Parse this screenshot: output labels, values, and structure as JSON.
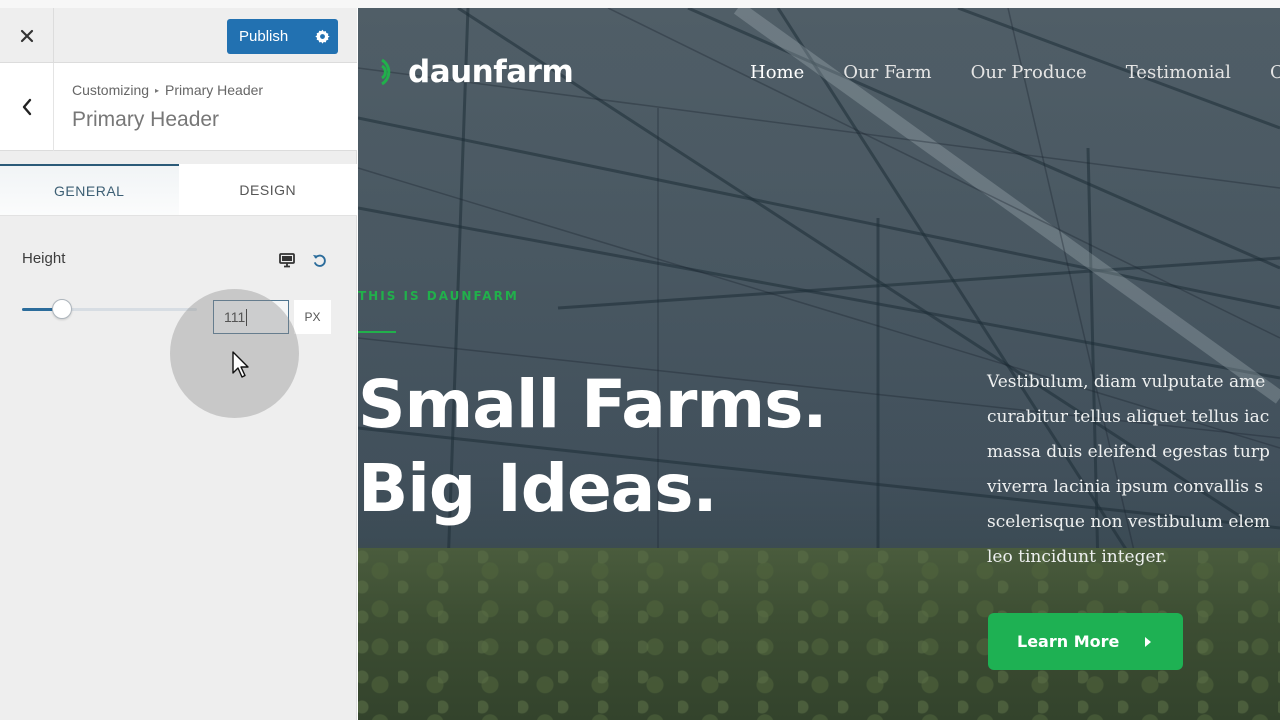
{
  "customizer": {
    "close_label": "Close",
    "publish_label": "Publish",
    "breadcrumb": {
      "root": "Customizing",
      "separator": "▸",
      "current": "Primary Header"
    },
    "section_title": "Primary Header",
    "tabs": [
      {
        "label": "GENERAL",
        "active": true
      },
      {
        "label": "DESIGN",
        "active": false
      }
    ],
    "height_control": {
      "label": "Height",
      "value": "111",
      "unit": "PX",
      "slider_fraction": 0.23
    },
    "colors": {
      "publish": "#2271b1",
      "tab_active": "#2b5a78"
    }
  },
  "preview": {
    "site_name": "daunfarm",
    "nav": [
      {
        "label": "Home",
        "active": true
      },
      {
        "label": "Our Farm",
        "active": false
      },
      {
        "label": "Our Produce",
        "active": false
      },
      {
        "label": "Testimonial",
        "active": false
      },
      {
        "label": "C",
        "active": false
      }
    ],
    "eyebrow": "THIS IS DAUNFARM",
    "hero_title_line1": "Small Farms.",
    "hero_title_line2": "Big Ideas.",
    "hero_copy": [
      "Vestibulum, diam vulputate ame",
      "curabitur tellus aliquet tellus iac",
      "massa duis eleifend egestas turp",
      "viverra lacinia ipsum convallis s",
      "scelerisque non vestibulum elem",
      "leo tincidunt integer."
    ],
    "cta_label": "Learn More",
    "colors": {
      "accent": "#21b04b",
      "cta": "#1eb153"
    }
  }
}
